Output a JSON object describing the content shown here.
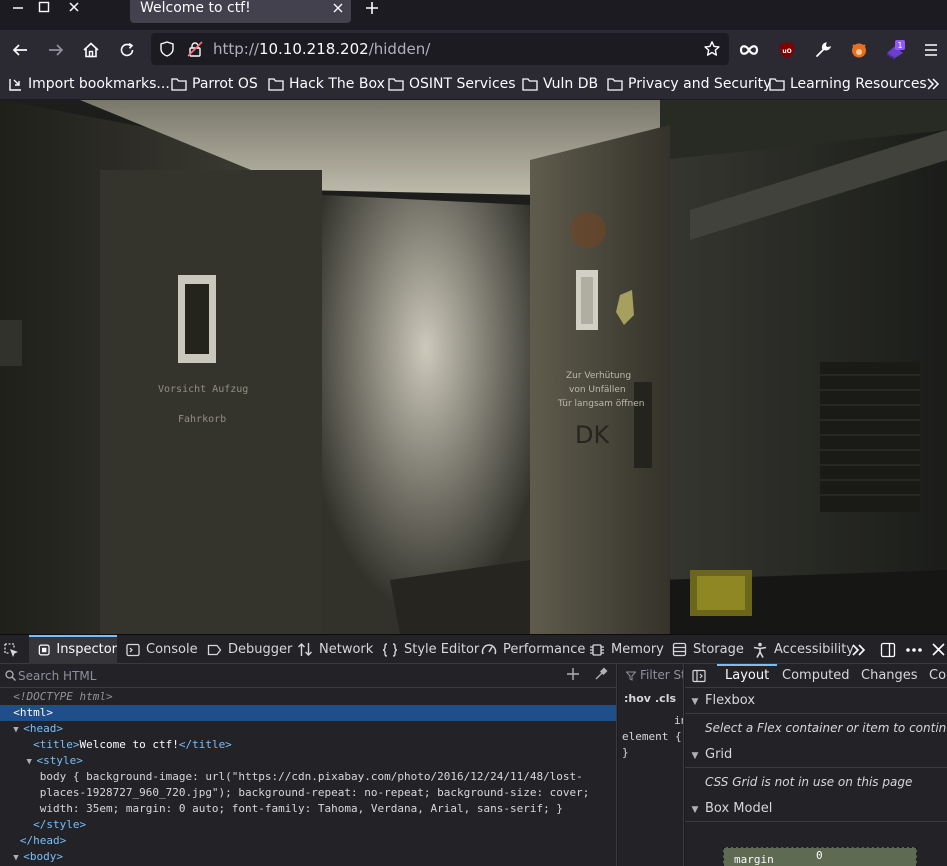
{
  "tab": {
    "title": "Welcome to ctf!"
  },
  "url": {
    "protocol": "http://",
    "host": "10.10.218.202",
    "path": "/hidden/"
  },
  "bookmarks": [
    {
      "label": "Import bookmarks...",
      "icon": "import-icon"
    },
    {
      "label": "Parrot OS",
      "icon": "folder-icon"
    },
    {
      "label": "Hack The Box",
      "icon": "folder-icon"
    },
    {
      "label": "OSINT Services",
      "icon": "folder-icon"
    },
    {
      "label": "Vuln DB",
      "icon": "folder-icon"
    },
    {
      "label": "Privacy and Security",
      "icon": "folder-icon"
    },
    {
      "label": "Learning Resources",
      "icon": "folder-icon"
    }
  ],
  "extensions": {
    "badge_count": "1"
  },
  "page_image": {
    "sign_text_left_1": "Vorsicht Aufzug",
    "sign_text_left_2": "Fahrkorb",
    "sign_text_right_1": "Zur Verhütung",
    "sign_text_right_2": "von Unfällen",
    "sign_text_right_3": "Tür langsam öffnen",
    "graffiti": "DK"
  },
  "devtools": {
    "tabs": [
      "Inspector",
      "Console",
      "Debugger",
      "Network",
      "Style Editor",
      "Performance",
      "Memory",
      "Storage",
      "Accessibility"
    ],
    "html_search_placeholder": "Search HTML",
    "filter_styles": "Filter Sty",
    "hov": ":hov",
    "cls": ".cls",
    "rule_partial": "in",
    "rule_element": "element {",
    "rule_close": "}",
    "tree": {
      "doctype": "<!DOCTYPE html>",
      "html_open": "<html>",
      "head_open": "<head>",
      "title_open": "<title>",
      "title_text": "Welcome to ctf!",
      "title_close": "</title>",
      "style_open": "<style>",
      "css_line_1": "body { background-image: url(\"https://cdn.pixabay.com/photo/2016/12/24/11/48/lost-",
      "css_line_2": "places-1928727_960_720.jpg\"); background-repeat: no-repeat; background-size: cover;",
      "css_line_3": "width: 35em; margin: 0 auto; font-family: Tahoma, Verdana, Arial, sans-serif; }",
      "style_close": "</style>",
      "head_close": "</head>",
      "body_open": "<body>"
    },
    "layout_tabs": [
      "Layout",
      "Computed",
      "Changes",
      "Co"
    ],
    "flexbox": {
      "title": "Flexbox",
      "note": "Select a Flex container or item to continue."
    },
    "grid": {
      "title": "Grid",
      "note": "CSS Grid is not in use on this page"
    },
    "box_model": {
      "title": "Box Model",
      "margin_label": "margin",
      "margin_value": "0"
    }
  }
}
